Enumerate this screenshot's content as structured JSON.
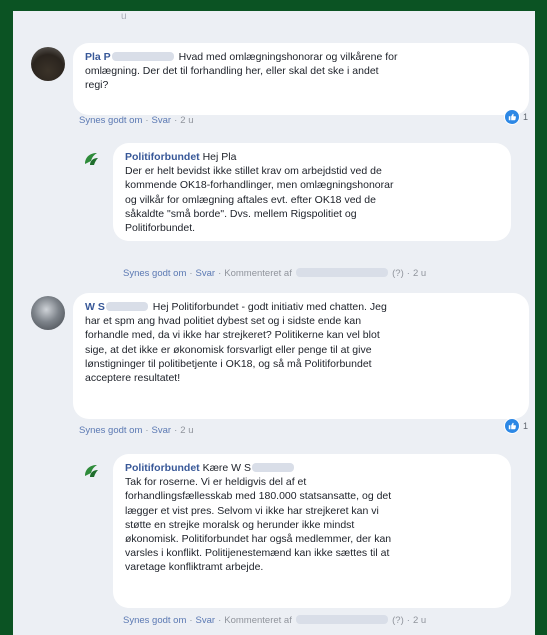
{
  "thread": {
    "top_marker": "u",
    "comments": [
      {
        "author": "Pla P",
        "text": "Hvad med omlægningshonorar og vilkårene for\nomlægning. Der det til forhandling her, eller skal det ske i andet\nregi?",
        "like_label": "Synes godt om",
        "reply_label": "Svar",
        "time": "2 u",
        "reaction_count": "1",
        "reply": {
          "author": "Politiforbundet",
          "greeting": "Hej Pla",
          "text": "Der er helt bevidst ikke stillet krav om arbejdstid ved de\nkommende OK18-forhandlinger, men omlægningshonorar\nog vilkår for omlægning aftales evt. efter OK18 ved de\nsåkaldte \"små borde\". Dvs. mellem Rigspolitiet og\nPolitiforbundet.",
          "like_label": "Synes godt om",
          "reply_label": "Svar",
          "commented_label": "Kommenteret af",
          "edited": "(?)",
          "time": "2 u"
        }
      },
      {
        "author": "W S",
        "text": "Hej Politiforbundet - godt initiativ med chatten. Jeg\nhar et spm ang hvad politiet dybest set og i sidste ende kan\nforhandle med, da vi ikke har strejkeret? Politikerne kan vel blot\nsige, at det ikke er økonomisk forsvarligt eller penge til at give\nlønstigninger til politibetjente i OK18, og så må Politiforbundet\nacceptere resultatet!",
        "like_label": "Synes godt om",
        "reply_label": "Svar",
        "time": "2 u",
        "reaction_count": "1",
        "reply": {
          "author": "Politiforbundet",
          "greeting": "Kære W S",
          "text": "Tak for roserne. Vi er heldigvis del af et\nforhandlingsfællesskab med 180.000 statsansatte, og det\nlægger et vist pres. Selvom vi ikke har strejkeret kan vi\nstøtte en strejke moralsk og herunder ikke mindst\nøkonomisk. Politiforbundet har også medlemmer, der kan\nvarsles i konflikt. Politijenestemænd kan ikke sættes til at\nvaretage konfliktramt arbejde.",
          "like_label": "Synes godt om",
          "reply_label": "Svar",
          "commented_label": "Kommenteret af",
          "edited": "(?)",
          "time": "2 u"
        }
      }
    ]
  },
  "colors": {
    "frame": "#0b5323",
    "panel": "#eceff4",
    "name": "#385898",
    "link": "#5b79b3",
    "like_badge": "#2d88e5"
  },
  "icons": {
    "like": "thumbs-up-icon",
    "author_logo": "politiforbundet-logo-icon"
  }
}
